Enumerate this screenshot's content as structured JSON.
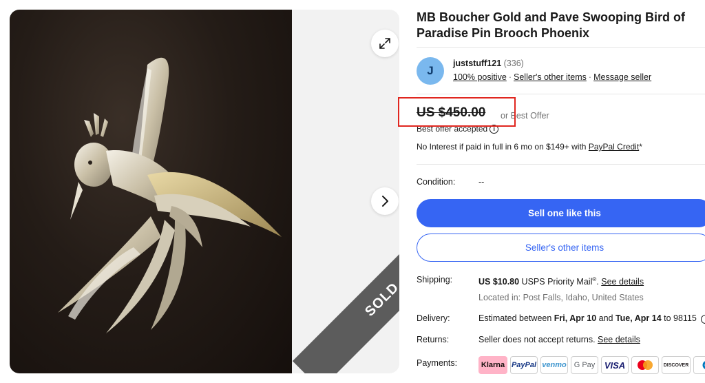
{
  "listing": {
    "title": "MB Boucher Gold and Pave Swooping Bird of Paradise Pin Brooch Phoenix",
    "sold_label": "SOLD"
  },
  "seller": {
    "initial": "J",
    "name": "juststuff121",
    "feedback_count": "(336)",
    "positive": "100% positive",
    "other_items": "Seller's other items",
    "message": "Message seller"
  },
  "price": {
    "amount": "US $450.00",
    "or_best_offer": "or Best Offer",
    "accepted": "Best offer accepted",
    "financing_prefix": "No Interest if paid in full in 6 mo on $149+ with ",
    "financing_link": "PayPal Credit",
    "financing_suffix": "*"
  },
  "condition": {
    "label": "Condition:",
    "value": "--"
  },
  "buttons": {
    "sell": "Sell one like this",
    "other_items": "Seller's other items"
  },
  "shipping": {
    "label": "Shipping:",
    "cost": "US $10.80",
    "service": " USPS Priority Mail",
    "reg": "®",
    "dot": ".",
    "details": "See details",
    "location": "Located in: Post Falls, Idaho, United States"
  },
  "delivery": {
    "label": "Delivery:",
    "text1": "Estimated between ",
    "date1": "Fri, Apr 10",
    "text2": " and ",
    "date2": "Tue, Apr 14",
    "text3": " to 98115"
  },
  "returns": {
    "label": "Returns:",
    "text": "Seller does not accept returns. ",
    "details": "See details"
  },
  "payments": {
    "label": "Payments:",
    "methods": [
      "Klarna",
      "PayPal",
      "venmo",
      "G Pay",
      "VISA",
      "",
      "DISCOVER",
      ""
    ]
  },
  "colors": {
    "accent": "#3665f3",
    "highlight": "#e0261f"
  }
}
